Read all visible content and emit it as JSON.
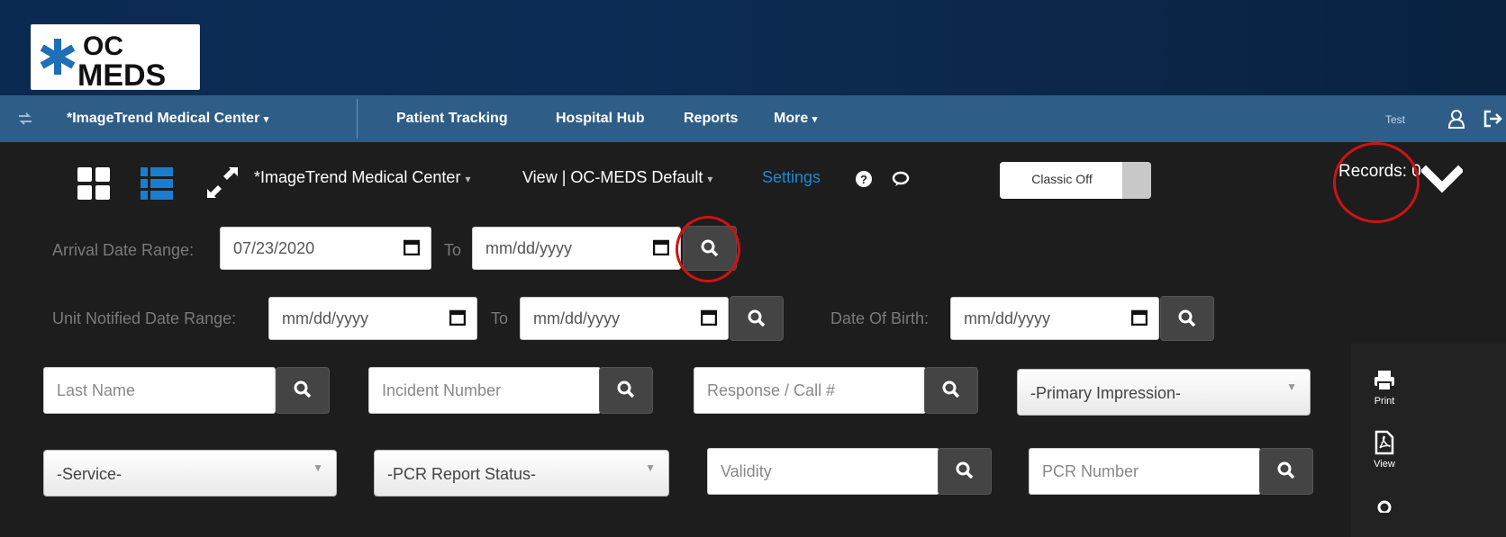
{
  "brand": {
    "logo_text": "OC MEDS"
  },
  "nav": {
    "facility_menu": "*ImageTrend Medical Center",
    "items": [
      "Patient Tracking",
      "Hospital Hub",
      "Reports",
      "More"
    ],
    "user_name": "Test"
  },
  "toolbar": {
    "facility": "*ImageTrend Medical Center",
    "view": "View | OC-MEDS Default",
    "settings": "Settings",
    "classic_toggle": "Classic Off",
    "records_label": "Records: 0"
  },
  "filters": {
    "arrival_label": "Arrival Date Range:",
    "arrival_from": "07/23/2020",
    "arrival_to": "mm/dd/yyyy",
    "to_label": "To",
    "unit_notified_label": "Unit Notified Date Range:",
    "unit_from": "mm/dd/yyyy",
    "unit_to": "mm/dd/yyyy",
    "dob_label": "Date Of Birth:",
    "dob": "mm/dd/yyyy",
    "last_name_ph": "Last  Name",
    "incident_ph": "Incident Number",
    "response_ph": "Response / Call #",
    "primary_impression": "-Primary Impression-",
    "service": "-Service-",
    "pcr_status": "-PCR Report Status-",
    "validity_ph": "Validity",
    "pcr_number_ph": "PCR Number"
  },
  "side_actions": {
    "print": "Print",
    "view": "View"
  }
}
